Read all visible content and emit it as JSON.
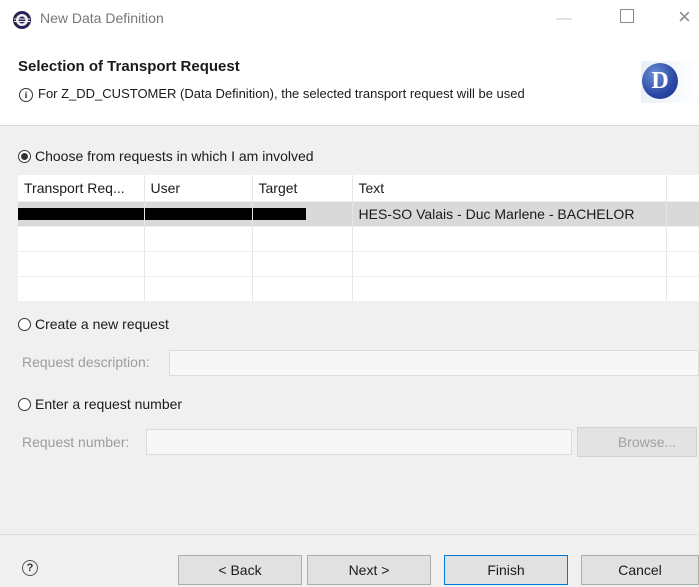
{
  "window": {
    "title": "New Data Definition",
    "icons": {
      "app": "eclipse-icon",
      "minimize": "minimize-icon",
      "maximize": "maximize-icon",
      "close": "close-icon"
    }
  },
  "header": {
    "title": "Selection of Transport Request",
    "message": "For Z_DD_CUSTOMER (Data Definition), the selected transport request will be used",
    "info_icon_glyph": "i",
    "badge_letter": "D",
    "badge_color": "#2948a6"
  },
  "options": {
    "choose": {
      "label": "Choose from requests in which I am involved",
      "checked": true
    },
    "create": {
      "label": "Create a new request",
      "checked": false
    },
    "enter": {
      "label": "Enter a request number",
      "checked": false
    }
  },
  "table": {
    "columns": [
      "Transport Req...",
      "User",
      "Target",
      "Text"
    ],
    "rows": [
      {
        "transport_request": "",
        "user": "",
        "target": "",
        "text": "HES-SO Valais - Duc Marlene - BACHELOR",
        "selected": true,
        "redacted": true
      }
    ],
    "empty_rows": 3
  },
  "create_section": {
    "description_label": "Request description:",
    "description_value": ""
  },
  "enter_section": {
    "number_label": "Request number:",
    "number_value": "",
    "browse_label": "Browse..."
  },
  "buttons": {
    "help_glyph": "?",
    "back": "< Back",
    "next": "Next >",
    "finish": "Finish",
    "cancel": "Cancel"
  },
  "colors": {
    "accent": "#0078d7",
    "selected_row": "#d9d9d9",
    "disabled_text": "#9c9c9c"
  }
}
